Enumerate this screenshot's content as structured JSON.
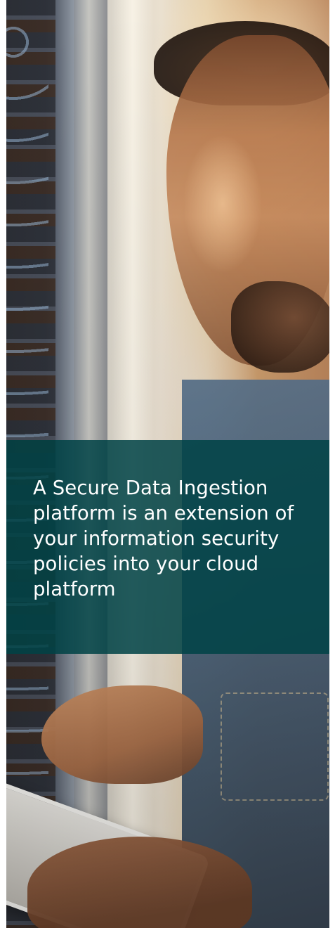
{
  "hero": {
    "overlay_text": "A Secure Data Ingestion platform is an extension of your information security policies into your cloud platform",
    "overlay_color": "#004246"
  },
  "photo": {
    "subject": "photo"
  }
}
